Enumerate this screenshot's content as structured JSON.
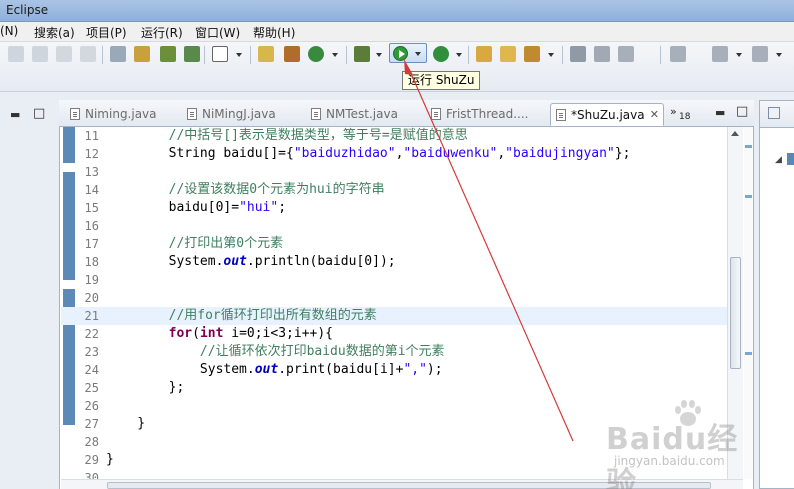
{
  "window": {
    "title": "Eclipse"
  },
  "menu": {
    "items": [
      "(N)",
      "搜索(a)",
      "项目(P)",
      "运行(R)",
      "窗口(W)",
      "帮助(H)"
    ]
  },
  "toolbar": {
    "run_button_icon": "run-icon",
    "tooltip": "运行 ShuZu"
  },
  "tabs": [
    {
      "label": "Niming.java",
      "active": false
    },
    {
      "label": "NiMingJ.java",
      "active": false
    },
    {
      "label": "NMTest.java",
      "active": false
    },
    {
      "label": "FristThread....",
      "active": false
    },
    {
      "label": "*ShuZu.java",
      "active": true
    }
  ],
  "tab_overflow": {
    "symbol": "»",
    "count": "18"
  },
  "code_lines": [
    {
      "n": "11",
      "text": "        //中括号[]表示是数据类型，等于号=是赋值的意思"
    },
    {
      "n": "12",
      "text": "        String baidu[]={\"baiduzhidao\",\"baiduwenku\",\"baidujingyan\"};"
    },
    {
      "n": "13",
      "text": ""
    },
    {
      "n": "14",
      "text": "        //设置该数据0个元素为hui的字符串"
    },
    {
      "n": "15",
      "text": "        baidu[0]=\"hui\";"
    },
    {
      "n": "16",
      "text": ""
    },
    {
      "n": "17",
      "text": "        //打印出第0个元素"
    },
    {
      "n": "18",
      "text": "        System.out.println(baidu[0]);"
    },
    {
      "n": "19",
      "text": ""
    },
    {
      "n": "20",
      "text": ""
    },
    {
      "n": "21",
      "text": "        //用for循环打印出所有数组的元素"
    },
    {
      "n": "22",
      "text": "        for(int i=0;i<3;i++){"
    },
    {
      "n": "23",
      "text": "            //让循环依次打印baidu数据的第i个元素"
    },
    {
      "n": "24",
      "text": "            System.out.print(baidu[i]+\",\");"
    },
    {
      "n": "25",
      "text": "        };"
    },
    {
      "n": "26",
      "text": ""
    },
    {
      "n": "27",
      "text": "    }"
    },
    {
      "n": "28",
      "text": ""
    },
    {
      "n": "29",
      "text": "}"
    },
    {
      "n": "30",
      "text": ""
    }
  ],
  "current_line": "21",
  "watermark": {
    "main": "Baidu经验",
    "sub": "jingyan.baidu.com"
  },
  "colors": {
    "keyword": "#7f0055",
    "string": "#2a00ff",
    "comment": "#3f7f5f",
    "annotation_arrow": "#d43a3a"
  }
}
